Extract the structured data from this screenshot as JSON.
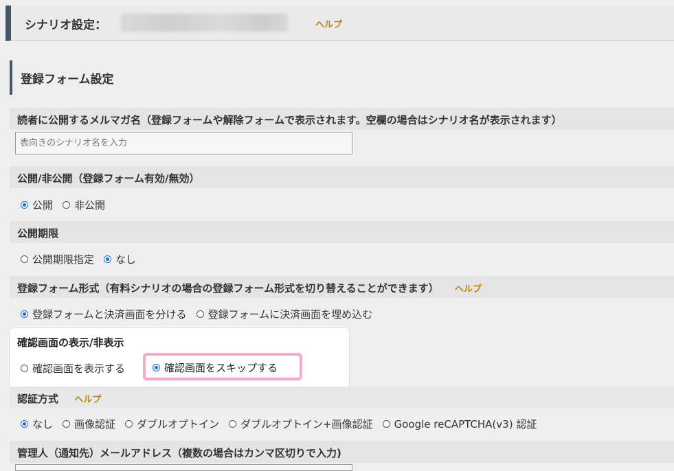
{
  "header": {
    "title": "シナリオ設定：",
    "help": "ヘルプ"
  },
  "section": {
    "title": "登録フォーム設定"
  },
  "public_name": {
    "label": "読者に公開するメルマガ名（登録フォームや解除フォームで表示されます。空欄の場合はシナリオ名が表示されます）",
    "placeholder": "表向きのシナリオ名を入力"
  },
  "visibility": {
    "label": "公開/非公開（登録フォーム有効/無効）",
    "options": [
      "公開",
      "非公開"
    ],
    "selected": "公開"
  },
  "deadline": {
    "label": "公開期限",
    "options": [
      "公開期限指定",
      "なし"
    ],
    "selected": "なし"
  },
  "form_type": {
    "label": "登録フォーム形式（有料シナリオの場合の登録フォーム形式を切り替えることができます）",
    "help": "ヘルプ",
    "options": [
      "登録フォームと決済画面を分ける",
      "登録フォームに決済画面を埋め込む"
    ],
    "selected": "登録フォームと決済画面を分ける"
  },
  "confirm_screen": {
    "label": "確認画面の表示/非表示",
    "options": [
      "確認画面を表示する",
      "確認画面をスキップする"
    ],
    "selected": "確認画面をスキップする"
  },
  "auth": {
    "label": "認証方式",
    "help": "ヘルプ",
    "options": [
      "なし",
      "画像認証",
      "ダブルオプトイン",
      "ダブルオプトイン+画像認証",
      "Google reCAPTCHA(v3) 認証"
    ],
    "selected": "なし"
  },
  "admin_email": {
    "label": "管理人（通知先）メールアドレス（複数の場合はカンマ区切りで入力)"
  },
  "colors": {
    "accent_bar": "#4a5563",
    "help": "#b8860b",
    "radio_selected": "#1a6fd6",
    "highlight": "#f7a8cf"
  }
}
